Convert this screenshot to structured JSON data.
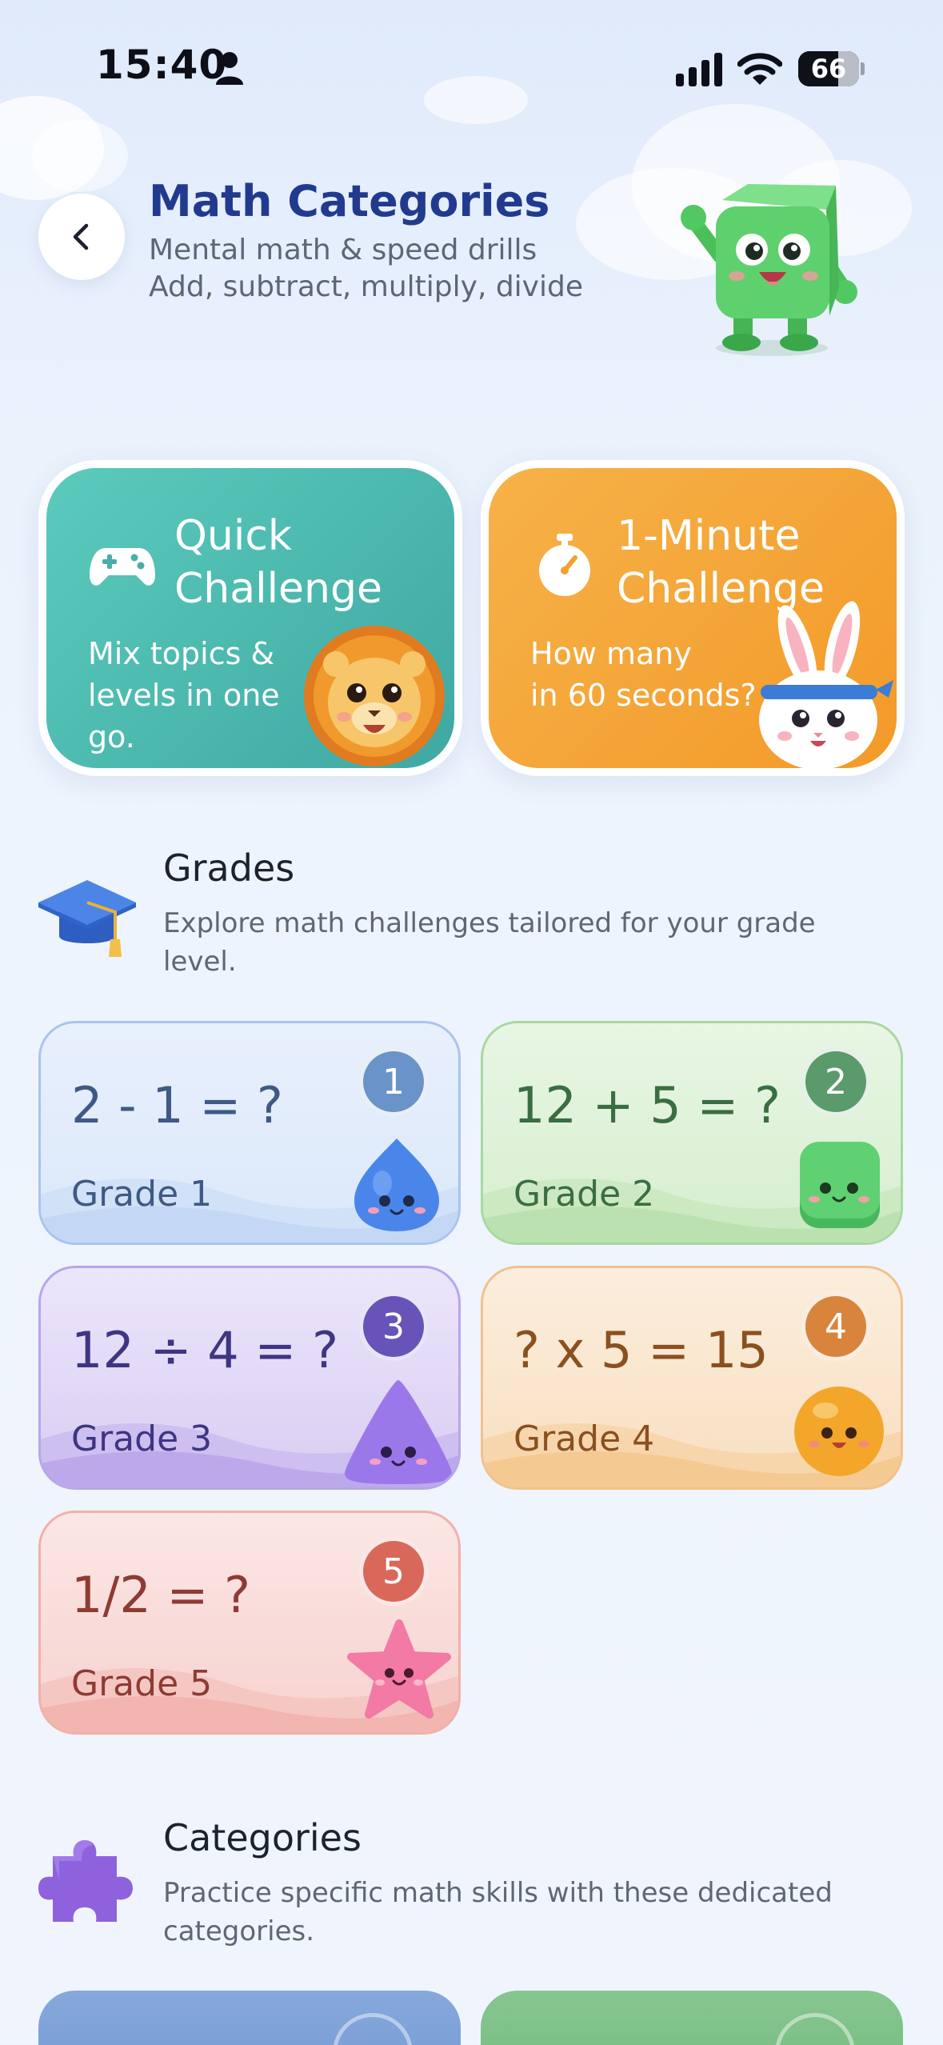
{
  "status_bar": {
    "time": "15:40",
    "battery": "66",
    "battery_level": 0.66
  },
  "header": {
    "title": "Math Categories",
    "subtitle_line1": "Mental math & speed drills",
    "subtitle_line2": "Add, subtract, multiply, divide"
  },
  "challenges": [
    {
      "title_line1": "Quick",
      "title_line2": "Challenge",
      "desc_line1": "Mix topics &",
      "desc_line2": "levels in one go.",
      "icon": "gamepad-icon",
      "color": "#49b7ad"
    },
    {
      "title_line1": "1-Minute",
      "title_line2": "Challenge",
      "desc_line1": "How many",
      "desc_line2": "in 60 seconds?",
      "icon": "stopwatch-icon",
      "color": "#f4a535"
    }
  ],
  "grades_section": {
    "title": "Grades",
    "description": "Explore math challenges tailored for your grade level.",
    "icon": "graduation-cap-icon"
  },
  "grades": [
    {
      "equation": "2 - 1 = ?",
      "label": "Grade 1",
      "badge": "1",
      "mascot": "blue-droplet-mascot-icon"
    },
    {
      "equation": "12 + 5 = ?",
      "label": "Grade 2",
      "badge": "2",
      "mascot": "green-cube-mascot-icon"
    },
    {
      "equation": "12 ÷ 4 = ?",
      "label": "Grade 3",
      "badge": "3",
      "mascot": "purple-triangle-mascot-icon"
    },
    {
      "equation": "? x 5 = 15",
      "label": "Grade 4",
      "badge": "4",
      "mascot": "orange-ball-mascot-icon"
    },
    {
      "equation": "1/2 = ?",
      "label": "Grade 5",
      "badge": "5",
      "mascot": "pink-star-mascot-icon"
    }
  ],
  "categories_section": {
    "title": "Categories",
    "description": "Practice specific math skills with these dedicated categories.",
    "icon": "puzzle-piece-icon"
  },
  "category_cards": [
    {
      "color": "#7fa3d8"
    },
    {
      "color": "#7cbf86"
    }
  ]
}
